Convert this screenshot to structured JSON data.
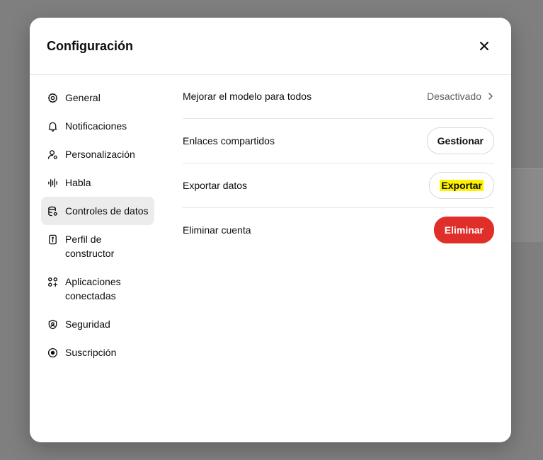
{
  "modal": {
    "title": "Configuración",
    "close_icon": "close-icon"
  },
  "sidebar": {
    "items": [
      {
        "label": "General",
        "icon": "gear-icon"
      },
      {
        "label": "Notificaciones",
        "icon": "bell-icon"
      },
      {
        "label": "Personalización",
        "icon": "user-settings-icon"
      },
      {
        "label": "Habla",
        "icon": "waveform-icon"
      },
      {
        "label": "Controles de datos",
        "icon": "database-icon",
        "active": true
      },
      {
        "label": "Perfil de constructor",
        "icon": "id-card-icon"
      },
      {
        "label": "Aplicaciones conectadas",
        "icon": "apps-icon"
      },
      {
        "label": "Seguridad",
        "icon": "shield-icon"
      },
      {
        "label": "Suscripción",
        "icon": "subscription-icon"
      }
    ]
  },
  "settings": {
    "improve_model": {
      "label": "Mejorar el modelo para todos",
      "value": "Desactivado"
    },
    "shared_links": {
      "label": "Enlaces compartidos",
      "button": "Gestionar"
    },
    "export_data": {
      "label": "Exportar datos",
      "button": "Exportar"
    },
    "delete_account": {
      "label": "Eliminar cuenta",
      "button": "Eliminar"
    }
  },
  "colors": {
    "overlay": "#7f7f7f",
    "danger": "#e02e2a",
    "highlight": "#fff200",
    "active_nav": "#ececec"
  }
}
